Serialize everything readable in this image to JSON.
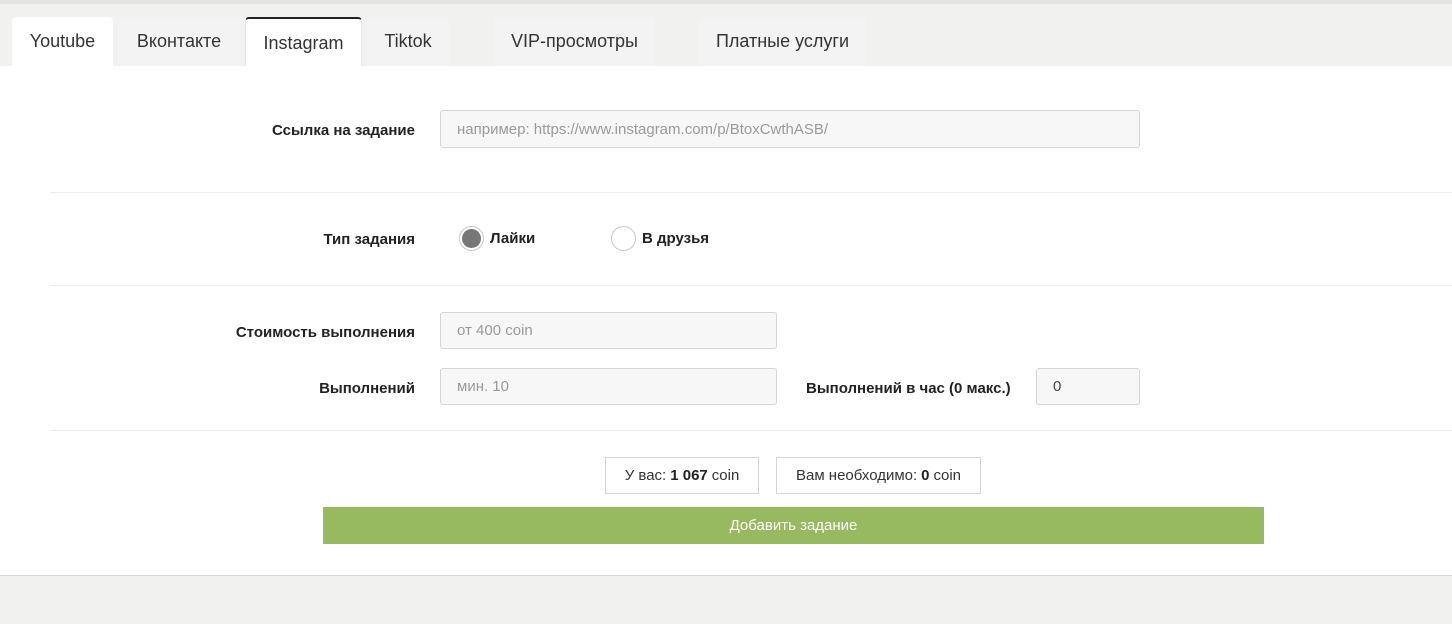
{
  "tabs": [
    {
      "label": "Youtube"
    },
    {
      "label": "Вконтакте"
    },
    {
      "label": "Instagram"
    },
    {
      "label": "Tiktok"
    },
    {
      "label": "VIP-просмотры"
    },
    {
      "label": "Платные услуги"
    }
  ],
  "active_tab": "Instagram",
  "form": {
    "link_label": "Ссылка на задание",
    "link_placeholder": "например: https://www.instagram.com/p/BtoxCwthASB/",
    "type_label": "Тип задания",
    "type_options": [
      {
        "label": "Лайки",
        "selected": true
      },
      {
        "label": "В друзья",
        "selected": false
      }
    ],
    "cost_label": "Стоимость выполнения",
    "cost_placeholder": "от 400 coin",
    "count_label": "Выполнений",
    "count_placeholder": "мин. 10",
    "per_hour_label": "Выполнений в час (0 макс.)",
    "per_hour_value": "0"
  },
  "balance": {
    "prefix": "У вас:",
    "amount": "1 067",
    "unit": "coin"
  },
  "required": {
    "prefix": "Вам необходимо:",
    "amount": "0",
    "unit": "coin"
  },
  "submit_label": "Добавить задание",
  "colors": {
    "submit_bg": "#97ba60",
    "radio_selected": "#777777"
  }
}
